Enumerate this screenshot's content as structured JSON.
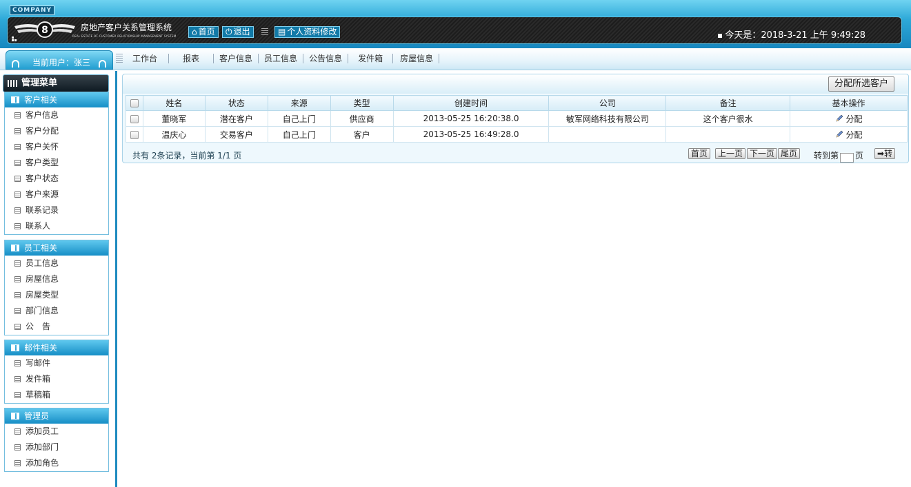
{
  "header": {
    "company": "COMPANY",
    "system_title": "房地产客户关系管理系统",
    "system_subtitle": "REAL ESTATE OF CUSTOMER RELATIONSHIP MANAGEMENT SYSTEM",
    "home_label": "首页",
    "logout_label": "退出",
    "profile_label": "个人资料修改",
    "today": "今天是：2018-3-21 上午 9:49:28"
  },
  "nav": {
    "current_user": "当前用户：张三",
    "links": [
      "工作台",
      "报表",
      "客户信息",
      "员工信息",
      "公告信息",
      "发件箱",
      "房屋信息"
    ]
  },
  "sidebar": {
    "menu_title": "管理菜单",
    "groups": [
      {
        "title": "客户相关",
        "items": [
          "客户信息",
          "客户分配",
          "客户关怀",
          "客户类型",
          "客户状态",
          "客户来源",
          "联系记录",
          "联系人"
        ]
      },
      {
        "title": "员工相关",
        "items": [
          "员工信息",
          "房屋信息",
          "房屋类型",
          "部门信息",
          "公　告"
        ]
      },
      {
        "title": "邮件相关",
        "items": [
          "写邮件",
          "发件箱",
          "草稿箱"
        ]
      },
      {
        "title": "管理员",
        "items": [
          "添加员工",
          "添加部门",
          "添加角色"
        ]
      }
    ]
  },
  "main": {
    "assign_button": "分配所选客户",
    "columns": [
      "姓名",
      "状态",
      "来源",
      "类型",
      "创建时间",
      "公司",
      "备注",
      "基本操作"
    ],
    "rows": [
      {
        "name": "董晓军",
        "status": "潜在客户",
        "source": "自己上门",
        "type": "供应商",
        "created": "2013-05-25 16:20:38.0",
        "company": "敏军网络科技有限公司",
        "note": "这个客户很水",
        "op": "分配"
      },
      {
        "name": "温庆心",
        "status": "交易客户",
        "source": "自己上门",
        "type": "客户",
        "created": "2013-05-25 16:49:28.0",
        "company": "",
        "note": "",
        "op": "分配"
      }
    ],
    "pager": {
      "info": "共有 2条记录，当前第 1/1 页",
      "first": "首页",
      "prev": "上一页",
      "next": "下一页",
      "last": "尾页",
      "goto_prefix": "转到第",
      "goto_suffix": "页",
      "go": "转"
    }
  }
}
